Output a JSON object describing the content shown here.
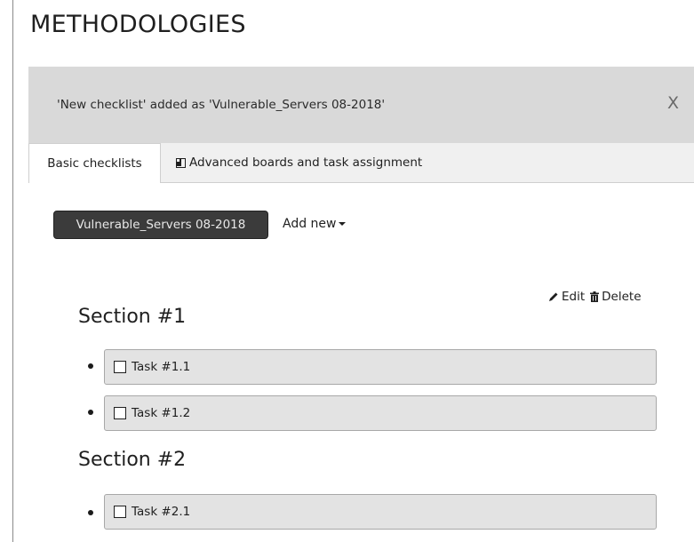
{
  "page": {
    "title": "METHODOLOGIES"
  },
  "alert": {
    "message": "'New checklist' added as 'Vulnerable_Servers 08-2018'",
    "close_label": "X"
  },
  "tabs": [
    {
      "label": "Basic checklists",
      "active": true
    },
    {
      "label": "Advanced boards and task assignment",
      "icon": "board-icon",
      "active": false
    }
  ],
  "toolbar": {
    "current_checklist": "Vulnerable_Servers 08-2018",
    "add_new_label": "Add new"
  },
  "actions": {
    "edit_label": "Edit",
    "delete_label": "Delete"
  },
  "sections": [
    {
      "title": "Section #1",
      "tasks": [
        {
          "label": "Task #1.1",
          "checked": false
        },
        {
          "label": "Task #1.2",
          "checked": false
        }
      ]
    },
    {
      "title": "Section #2",
      "tasks": [
        {
          "label": "Task #2.1",
          "checked": false
        }
      ]
    }
  ]
}
